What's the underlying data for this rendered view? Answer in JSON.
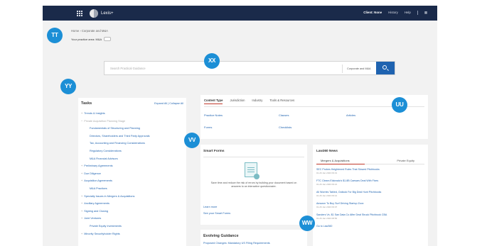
{
  "topbar": {
    "app_name": "Lexis+",
    "nav": [
      "Client: None",
      "History",
      "Help"
    ]
  },
  "breadcrumb": "Home  ›  Corporate and M&A",
  "subheader": "Your practice area: M&A",
  "search": {
    "placeholder": "Search Practical Guidance",
    "scope": "Corporate and M&A"
  },
  "tasks": {
    "title": "Tasks",
    "links": "Expand All  |  Collapse All",
    "items": [
      {
        "label": "Trends & Insights",
        "sub": false,
        "open": false
      },
      {
        "label": "Private Acquisition Planning Stage",
        "sub": false,
        "open": true
      },
      {
        "label": "Fundamentals of Structuring and Planning",
        "sub": true,
        "open": false
      },
      {
        "label": "Directors, Shareholders and Third Party Approvals",
        "sub": true,
        "open": false
      },
      {
        "label": "Tax, Accounting and Financing Considerations",
        "sub": true,
        "open": false
      },
      {
        "label": "Regulatory Considerations",
        "sub": true,
        "open": false
      },
      {
        "label": "M&A Financial Advisors",
        "sub": true,
        "open": false
      },
      {
        "label": "Preliminary Agreements",
        "sub": false,
        "open": false
      },
      {
        "label": "Due Diligence",
        "sub": false,
        "open": false
      },
      {
        "label": "Acquisition Agreements",
        "sub": false,
        "open": false
      },
      {
        "label": "M&A Practices",
        "sub": true,
        "open": false
      },
      {
        "label": "Specialty Issues in Mergers & Acquisitions",
        "sub": false,
        "open": false
      },
      {
        "label": "Ancillary Agreements",
        "sub": false,
        "open": false
      },
      {
        "label": "Signing and Closing",
        "sub": false,
        "open": false
      },
      {
        "label": "Joint Ventures",
        "sub": false,
        "open": false
      },
      {
        "label": "Private Equity Investments",
        "sub": true,
        "open": false
      },
      {
        "label": "Minority Securityholder Rights",
        "sub": false,
        "open": false
      }
    ]
  },
  "content_types": {
    "tabs": [
      "Content Type",
      "Jurisdiction",
      "Industry",
      "Tools & Resources"
    ],
    "cells": [
      "Practice Notes",
      "Clauses",
      "Articles",
      "Forms",
      "Checklists"
    ]
  },
  "smart_forms": {
    "title": "Smart Forms",
    "description": "Save time and reduce the risk of errors by building your document based on answers to an interactive questionnaire.",
    "learn_more": "Learn more",
    "see_link": "See your Smart Forms"
  },
  "evolving": {
    "title": "Evolving Guidance",
    "item": "Proposed Changes: Mandatory US Filing Requirements"
  },
  "news": {
    "title": "Law360 News",
    "tabs": [
      "Mergers & Acquisitions",
      "Private Equity"
    ],
    "items": [
      {
        "title": "SEC Probes Heightened Rules That Slowed Pitchbooks",
        "date": "01-26 Jan 2023 09:31"
      },
      {
        "title": "FTC Clears Eldorado's $1.8B Caesars Deal With Fixes",
        "date": "01-26 Jan 2023 09:21"
      },
      {
        "title": "All Worries Tabled, Outlook For Big Deal Hunt Pitchbooks",
        "date": "01-26 Jan 2023 09:12"
      },
      {
        "title": "Amazon To Buy Surf Driving Startup Zoox",
        "date": "01-26 Jan 2023 09:07"
      },
      {
        "title": "Sanders Vs. $1 San Data Co After Deal Struck Pitchbook CBA",
        "date": "01-26 Jan 2023 08:50"
      },
      {
        "title": "Go to Law360",
        "date": ""
      }
    ]
  },
  "badges": [
    "TT",
    "XX",
    "YY",
    "UU",
    "VV",
    "WW"
  ]
}
